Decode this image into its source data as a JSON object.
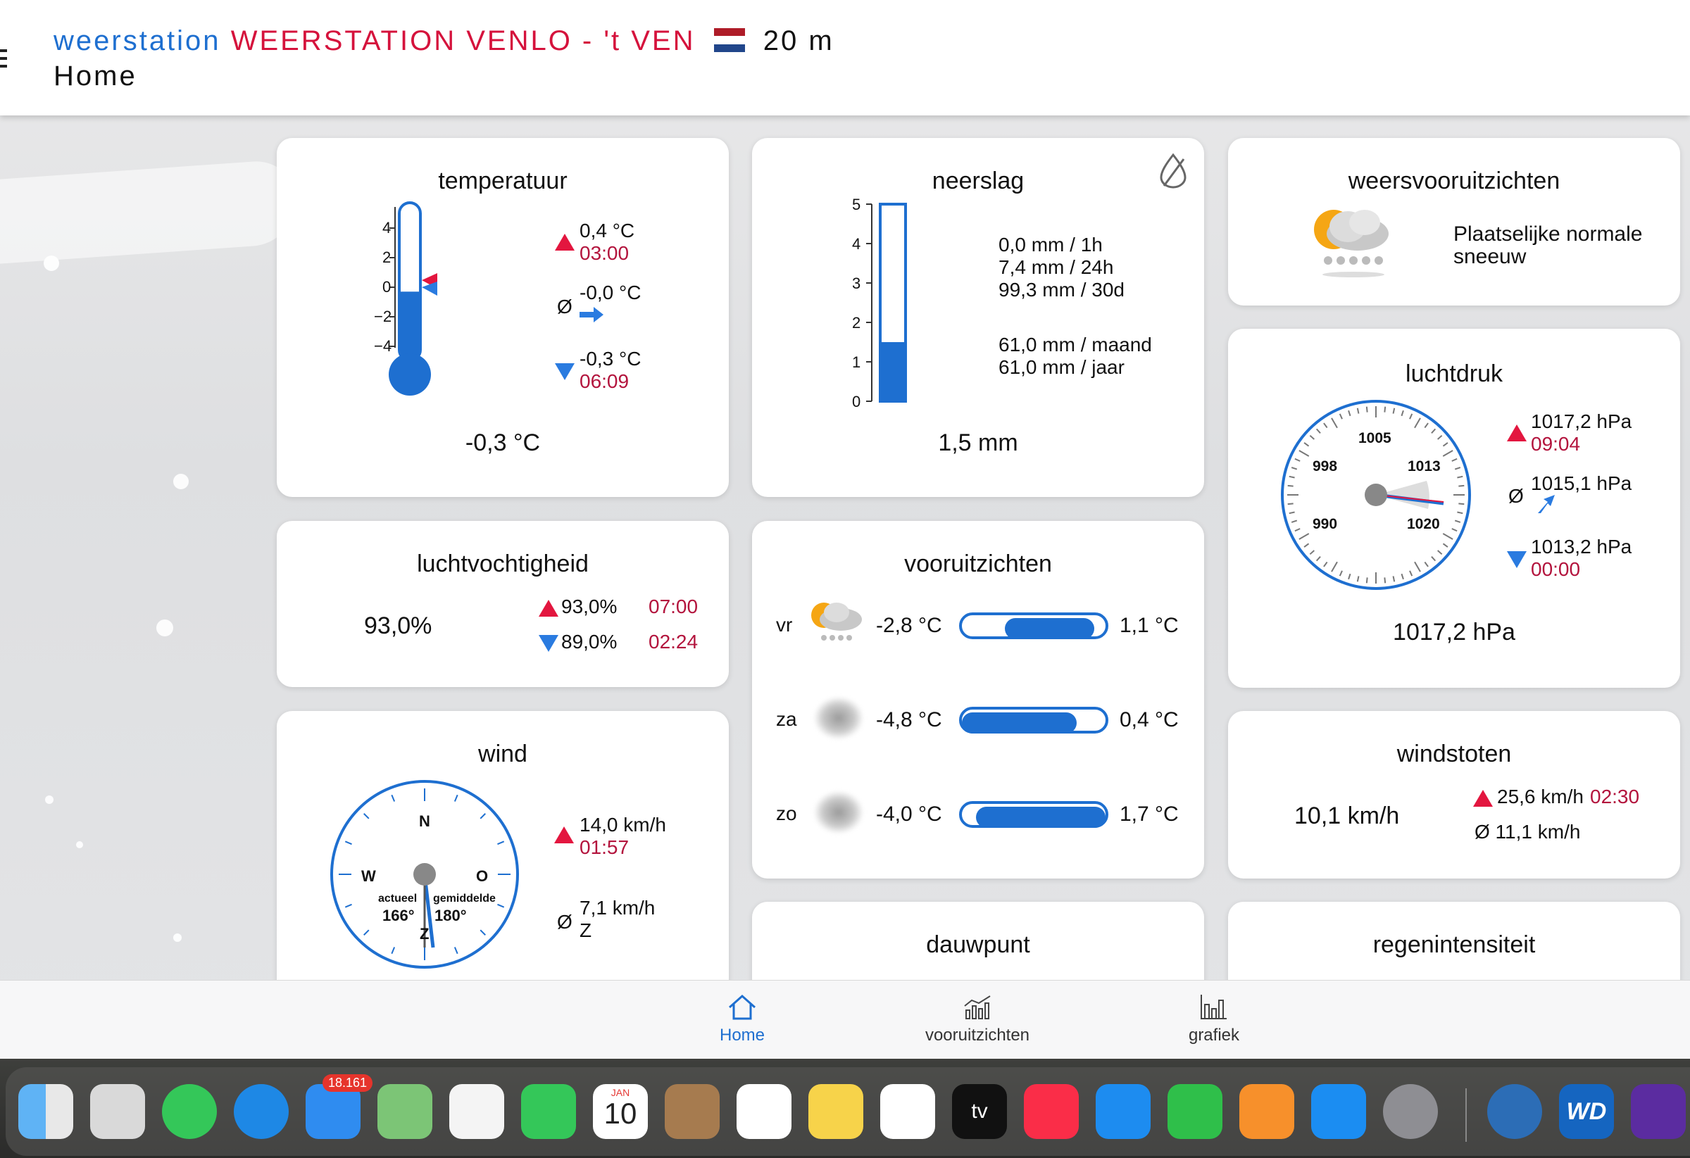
{
  "header": {
    "prefix": "weerstation",
    "station": "WEERSTATION VENLO - 't VEN",
    "altitude": "20 m",
    "page": "Home",
    "flag_colors": [
      "#ae1c28",
      "#ffffff",
      "#21468b"
    ]
  },
  "temperature": {
    "title": "temperatuur",
    "scale": [
      "4",
      "2",
      "0",
      "−2",
      "−4"
    ],
    "max_value": "0,4 °C",
    "max_time": "03:00",
    "avg_symbol": "Ø",
    "avg_value": "-0,0 °C",
    "min_value": "-0,3 °C",
    "min_time": "06:09",
    "current": "-0,3 °C",
    "level": -0.3
  },
  "precipitation": {
    "title": "neerslag",
    "scale": [
      "5",
      "4",
      "3",
      "2",
      "1",
      "0"
    ],
    "line1": "0,0 mm  / 1h",
    "line2": "7,4 mm  / 24h",
    "line3": "99,3 mm  / 30d",
    "line4": "61,0 mm  / maand",
    "line5": "61,0 mm  / jaar",
    "current": "1,5 mm",
    "level": 1.5
  },
  "forecast_summary": {
    "title": "weersvooruitzichten",
    "text1": "Plaatselijke normale",
    "text2": "sneeuw"
  },
  "pressure": {
    "title": "luchtdruk",
    "dial": [
      "1005",
      "998",
      "1013",
      "990",
      "1020"
    ],
    "max_value": "1017,2 hPa",
    "max_time": "09:04",
    "avg_symbol": "Ø",
    "avg_value": "1015,1 hPa",
    "min_value": "1013,2 hPa",
    "min_time": "00:00",
    "current": "1017,2 hPa"
  },
  "humidity": {
    "title": "luchtvochtigheid",
    "current": "93,0%",
    "max_value": "93,0%",
    "max_time": "07:00",
    "min_value": "89,0%",
    "min_time": "02:24"
  },
  "outlook": {
    "title": "vooruitzichten",
    "days": [
      {
        "day": "vr",
        "low": "-2,8 °C",
        "high": "1,1 °C",
        "range": [
          0.3,
          0.92
        ]
      },
      {
        "day": "za",
        "low": "-4,8 °C",
        "high": "0,4 °C",
        "range": [
          0.0,
          0.8
        ]
      },
      {
        "day": "zo",
        "low": "-4,0 °C",
        "high": "1,7 °C",
        "range": [
          0.1,
          1.0
        ]
      }
    ]
  },
  "wind": {
    "title": "wind",
    "compass": {
      "n": "N",
      "w": "W",
      "o": "O",
      "z": "Z"
    },
    "actual_label": "actueel",
    "actual_deg": "166°",
    "avg_label": "gemiddelde",
    "avg_deg": "180°",
    "max_value": "14,0 km/h",
    "max_time": "01:57",
    "avg_symbol": "Ø",
    "avg_value": "7,1 km/h",
    "avg_dir": "Z"
  },
  "gusts": {
    "title": "windstoten",
    "current": "10,1 km/h",
    "max_value": "25,6 km/h",
    "max_time": "02:30",
    "avg_text": "Ø 11,1 km/h"
  },
  "dewpoint": {
    "title": "dauwpunt"
  },
  "rain_intensity": {
    "title": "regenintensiteit"
  },
  "tabs": {
    "home": "Home",
    "forecast": "vooruitzichten",
    "graph": "grafiek"
  },
  "dock": {
    "mail_badge": "18.161",
    "calendar_month": "JAN",
    "calendar_day": "10",
    "tv_label": "tv",
    "wd_label": "WD"
  }
}
